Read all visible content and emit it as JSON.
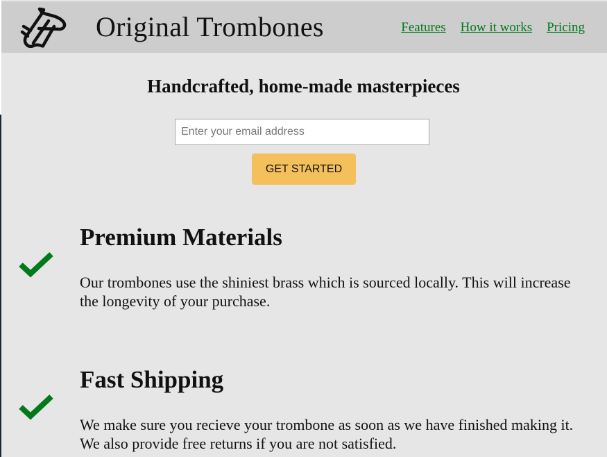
{
  "header": {
    "brand": "Original Trombones",
    "logo_icon": "trombone-icon",
    "nav": [
      {
        "label": "Features"
      },
      {
        "label": "How it works"
      },
      {
        "label": "Pricing"
      }
    ],
    "colors": {
      "background": "#cdcdcd",
      "link": "#007a1a"
    }
  },
  "hero": {
    "tagline": "Handcrafted, home-made masterpieces",
    "email_placeholder": "Enter your email address",
    "cta_label": "GET STARTED",
    "cta_color": "#f4c05b"
  },
  "features": [
    {
      "icon": "check-icon",
      "title": "Premium Materials",
      "description": "Our trombones use the shiniest brass which is sourced locally. This will increase the longevity of your purchase."
    },
    {
      "icon": "check-icon",
      "title": "Fast Shipping",
      "description": "We make sure you recieve your trombone as soon as we have finished making it. We also provide free returns if you are not satisfied."
    }
  ],
  "colors": {
    "page_background": "#e6e6e6",
    "check": "#007a1a"
  }
}
